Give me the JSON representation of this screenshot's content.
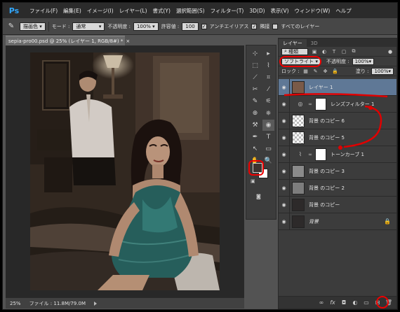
{
  "app": {
    "logo": "Ps"
  },
  "menu": [
    "ファイル(F)",
    "編集(E)",
    "イメージ(I)",
    "レイヤー(L)",
    "書式(Y)",
    "選択範囲(S)",
    "フィルター(T)",
    "3D(D)",
    "表示(V)",
    "ウィンドウ(W)",
    "ヘルプ"
  ],
  "options": {
    "tool_icon": "brush-icon",
    "preset": "描画色",
    "mode_label": "モード :",
    "mode_value": "通常",
    "opacity_label": "不透明度 :",
    "opacity_value": "100%",
    "tolerance_label": "許容値 :",
    "tolerance_value": "100",
    "antialias_label": "アンチエイリアス",
    "contiguous_label": "隣接",
    "all_layers_label": "すべてのレイヤー"
  },
  "document": {
    "tab_title": "sepia-pro00.psd @ 25% (レイヤー 1, RGB/8#) *",
    "close": "×"
  },
  "status": {
    "zoom": "25%",
    "file_info": "ファイル : 11.8M/79.0M"
  },
  "toolbox": {
    "tools": [
      "⊹",
      "▸",
      "⬚",
      "⌇",
      "⟋",
      "⌗",
      "✂",
      "⁄",
      "✎",
      "⚟",
      "⊕",
      "⎈",
      "⚒",
      "◉",
      "✒",
      "T",
      "↖",
      "▭",
      "✋",
      "🔍"
    ]
  },
  "layers_panel": {
    "tabs": [
      "レイヤー",
      "3D"
    ],
    "filter_label": "種類",
    "blend_mode": "ソフトライト",
    "opacity_label": "不透明度 :",
    "opacity_value": "100%",
    "lock_label": "ロック :",
    "fill_label": "塗り :",
    "fill_value": "100%",
    "layers": [
      {
        "name": "レイヤー 1",
        "thumb": "#7a5a48"
      },
      {
        "name": "レンズフィルター 1"
      },
      {
        "name": "背景 のコピー 6",
        "thumb": "checker"
      },
      {
        "name": "背景 のコピー 5",
        "thumb": "checker"
      },
      {
        "name": "トーンカーブ 1"
      },
      {
        "name": "背景 のコピー 3",
        "thumb": "#8a8a8a"
      },
      {
        "name": "背景 のコピー 2",
        "thumb": "#7d7d7d"
      },
      {
        "name": "背景 のコピー",
        "thumb": "#2d2a2a"
      },
      {
        "name": "背景",
        "thumb": "#2d2a2a"
      }
    ],
    "footer_icons": [
      "link-icon",
      "fx-icon",
      "mask-icon",
      "adjustment-icon",
      "folder-icon",
      "new-layer-icon",
      "trash-icon"
    ]
  },
  "colors": {
    "selected_layer": "#5f7896",
    "annotation": "#e00000",
    "foreground": "#3e3330",
    "background": "#ffffff"
  }
}
